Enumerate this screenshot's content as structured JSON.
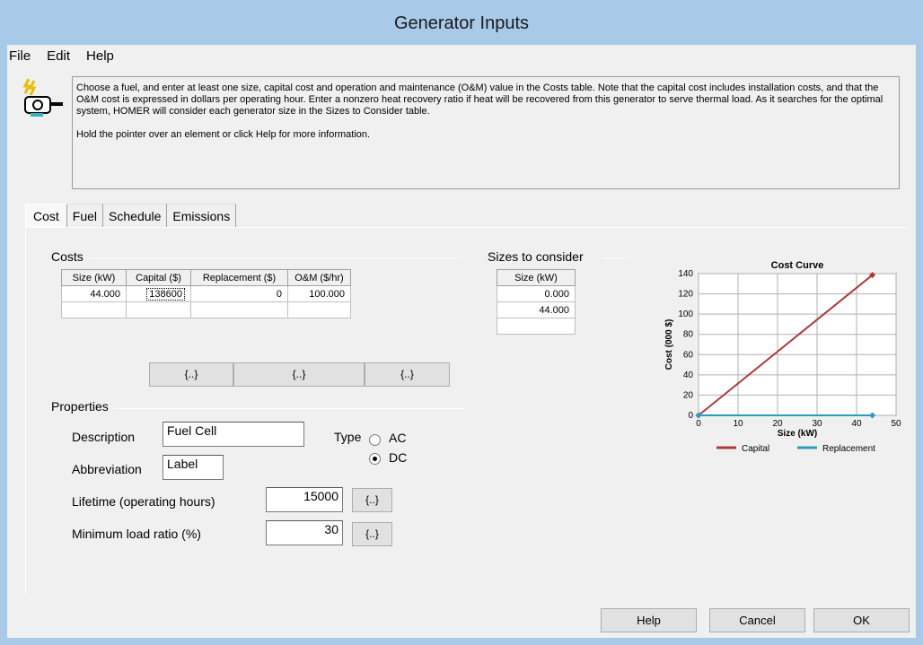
{
  "window": {
    "title": "Generator Inputs"
  },
  "menu": [
    "File",
    "Edit",
    "Help"
  ],
  "info": {
    "paragraph1": "Choose a fuel, and enter at least one size, capital cost and operation and maintenance (O&M) value in the Costs table. Note that the capital cost includes installation costs, and that the O&M cost is expressed in dollars per operating hour. Enter a nonzero heat recovery ratio if heat will be recovered from this generator to serve thermal load. As it searches for the optimal system, HOMER will consider each generator size in the Sizes to Consider table.",
    "paragraph2": "Hold the pointer over an element or click Help for more information."
  },
  "tabs": [
    "Cost",
    "Fuel",
    "Schedule",
    "Emissions"
  ],
  "costs": {
    "label": "Costs",
    "headers": [
      "Size (kW)",
      "Capital ($)",
      "Replacement ($)",
      "O&M ($/hr)"
    ],
    "rows": [
      [
        "44.000",
        "138600",
        "0",
        "100.000"
      ],
      [
        "",
        "",
        "",
        ""
      ]
    ],
    "buttons": [
      "{..}",
      "{..}",
      "{..}"
    ]
  },
  "sizes": {
    "label": "Sizes to consider",
    "header": "Size (kW)",
    "rows": [
      "0.000",
      "44.000",
      ""
    ]
  },
  "properties": {
    "label": "Properties",
    "description_label": "Description",
    "description_value": "Fuel Cell",
    "abbreviation_label": "Abbreviation",
    "abbreviation_value": "Label",
    "type_label": "Type",
    "type_options": [
      "AC",
      "DC"
    ],
    "type_selected": "DC",
    "lifetime_label": "Lifetime (operating hours)",
    "lifetime_value": "15000",
    "min_load_label": "Minimum load ratio (%)",
    "min_load_value": "30",
    "sens_button": "{..}"
  },
  "chart_data": {
    "type": "line",
    "title": "Cost Curve",
    "xlabel": "Size (kW)",
    "ylabel": "Cost (000 $)",
    "xlim": [
      0,
      50
    ],
    "ylim": [
      0,
      140
    ],
    "xticks": [
      0,
      10,
      20,
      30,
      40,
      50
    ],
    "yticks": [
      0,
      20,
      40,
      60,
      80,
      100,
      120,
      140
    ],
    "grid": true,
    "legend": "bottom",
    "series": [
      {
        "name": "Capital",
        "color": "#b03a3a",
        "x": [
          0,
          44
        ],
        "y": [
          0,
          138.6
        ]
      },
      {
        "name": "Replacement",
        "color": "#2b9bc4",
        "x": [
          0,
          44
        ],
        "y": [
          0,
          0
        ]
      }
    ]
  },
  "footer": {
    "help": "Help",
    "cancel": "Cancel",
    "ok": "OK"
  }
}
